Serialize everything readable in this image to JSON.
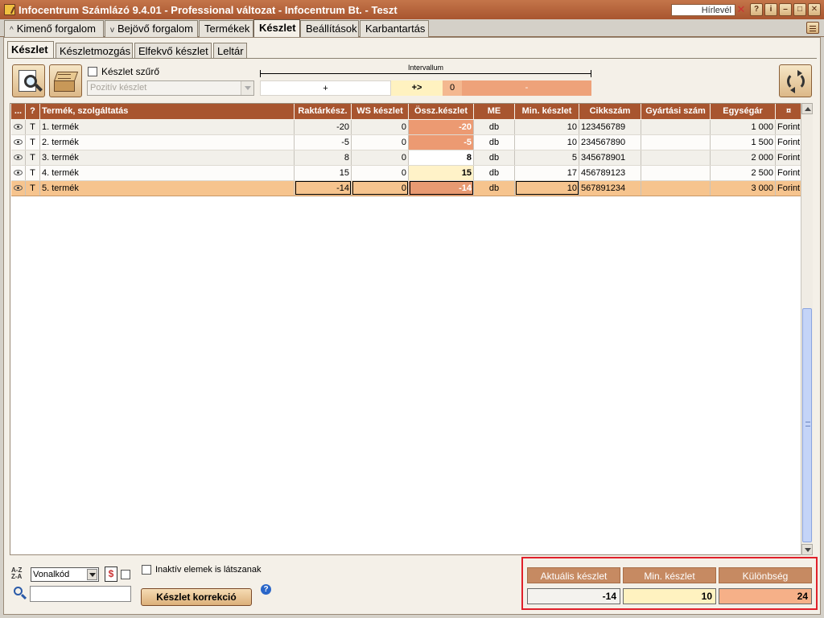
{
  "window": {
    "title": "Infocentrum Számlázó 9.4.01 - Professional változat - Infocentrum Bt. - Teszt",
    "news_label": "Hírlevél",
    "close_x": "✕",
    "help_btn": "?",
    "info_btn": "i",
    "min_btn": "–",
    "max_btn": "□",
    "close_btn": "✕"
  },
  "main_tabs": [
    {
      "label": "Kimenő forgalom",
      "chevron": "^"
    },
    {
      "label": "Bejövő forgalom",
      "chevron": "v"
    },
    {
      "label": "Termékek"
    },
    {
      "label": "Készlet",
      "active": true
    },
    {
      "label": "Beállítások"
    },
    {
      "label": "Karbantartás"
    }
  ],
  "sub_tabs": [
    {
      "label": "Készlet",
      "active": true
    },
    {
      "label": "Készletmozgás"
    },
    {
      "label": "Elfekvő készlet"
    },
    {
      "label": "Leltár"
    }
  ],
  "toolbar": {
    "filter_checkbox_label": "Készlet szűrő",
    "filter_select_value": "Pozitív készlet",
    "interval_title": "Intervallum",
    "interval_plus": "+",
    "interval_arrow": "+>",
    "interval_zero": "0",
    "interval_minus": "-"
  },
  "grid": {
    "headers": [
      "...",
      "?",
      "Termék, szolgáltatás",
      "Raktárkész.",
      "WS készlet",
      "Össz.készlet",
      "ME",
      "Min. készlet",
      "Cikkszám",
      "Gyártási szám",
      "Egységár",
      "¤"
    ],
    "rows": [
      {
        "type": "T",
        "name": "1. termék",
        "raktar": "-20",
        "ws": "0",
        "ossz": "-20",
        "me": "db",
        "min": "10",
        "cikk": "123456789",
        "gyart": "",
        "ar": "1 000",
        "penz": "Forint"
      },
      {
        "type": "T",
        "name": "2. termék",
        "raktar": "-5",
        "ws": "0",
        "ossz": "-5",
        "me": "db",
        "min": "10",
        "cikk": "234567890",
        "gyart": "",
        "ar": "1 500",
        "penz": "Forint"
      },
      {
        "type": "T",
        "name": "3. termék",
        "raktar": "8",
        "ws": "0",
        "ossz": "8",
        "me": "db",
        "min": "5",
        "cikk": "345678901",
        "gyart": "",
        "ar": "2 000",
        "penz": "Forint"
      },
      {
        "type": "T",
        "name": "4. termék",
        "raktar": "15",
        "ws": "0",
        "ossz": "15",
        "me": "db",
        "min": "17",
        "cikk": "456789123",
        "gyart": "",
        "ar": "2 500",
        "penz": "Forint"
      },
      {
        "type": "T",
        "name": "5. termék",
        "raktar": "-14",
        "ws": "0",
        "ossz": "-14",
        "me": "db",
        "min": "10",
        "cikk": "567891234",
        "gyart": "",
        "ar": "3 000",
        "penz": "Forint"
      }
    ]
  },
  "footer": {
    "sort_icon_top": "A-Z",
    "sort_icon_bottom": "Z-A",
    "sort_select_value": "Vonalkód",
    "money_symbol": "$",
    "inactive_label": "Inaktív elemek is látszanak",
    "correction_button": "Készlet korrekció",
    "help_symbol": "?"
  },
  "summary": {
    "current_label": "Aktuális készlet",
    "min_label": "Min. készlet",
    "diff_label": "Különbség",
    "current_value": "-14",
    "min_value": "10",
    "diff_value": "24"
  },
  "colors": {
    "titlebar": "#a8552f",
    "header_bg": "#a8552f",
    "negative_stock": "#ec9a72",
    "low_stock": "#fff2c8",
    "selected_row": "#f6c48e",
    "summary_border": "#e0202a"
  }
}
